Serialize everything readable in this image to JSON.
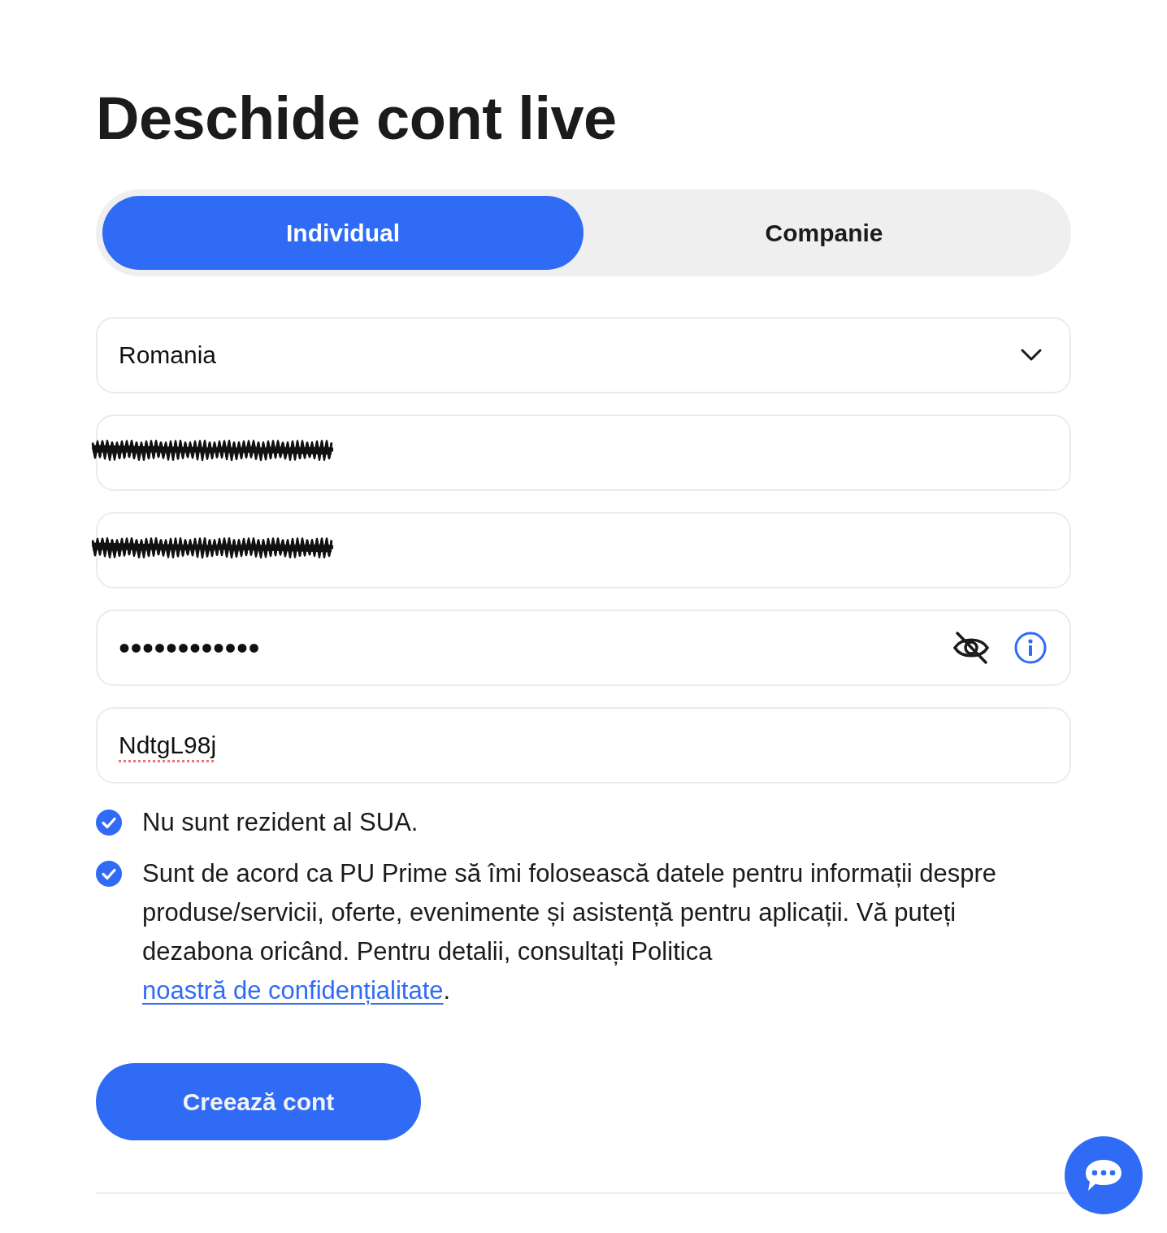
{
  "title": "Deschide cont live",
  "account_type_tabs": [
    {
      "label": "Individual",
      "selected": true
    },
    {
      "label": "Companie",
      "selected": false
    }
  ],
  "fields": [
    {
      "kind": "select",
      "value": "Romania"
    },
    {
      "kind": "redacted"
    },
    {
      "kind": "redacted"
    },
    {
      "kind": "password",
      "value": "••••••••••••"
    },
    {
      "kind": "text",
      "value": "NdtgL98j",
      "misspelled": true
    }
  ],
  "agreements": [
    {
      "checked": true,
      "text": "Nu sunt rezident al SUA."
    },
    {
      "checked": true,
      "text": "Sunt de acord ca PU Prime să îmi folosească datele pentru informații despre produse/servicii, oferte, evenimente și asistență pentru aplicații. Vă puteți dezabona oricând. Pentru detalii, consultați Politica ",
      "link": "noastră de confidențialitate",
      "text_after": "."
    }
  ],
  "submit_button": "Creează cont"
}
